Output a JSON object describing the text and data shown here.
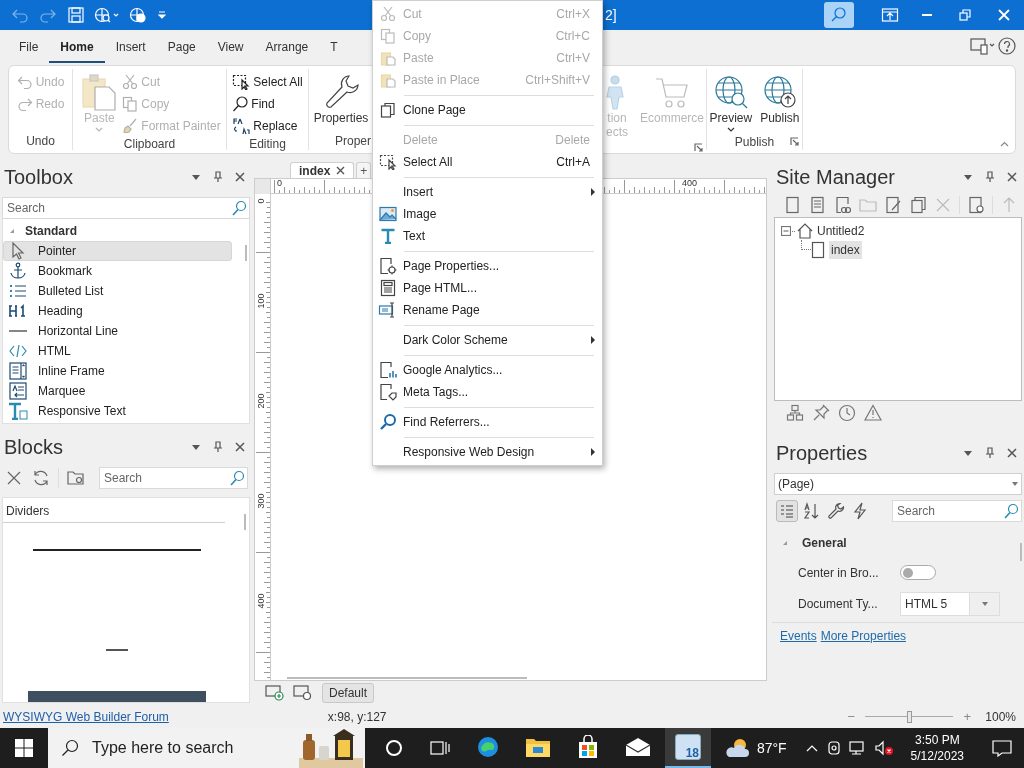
{
  "title_bar": {
    "title": "2]"
  },
  "ribbon": {
    "tabs": [
      {
        "label": "File",
        "selected": false
      },
      {
        "label": "Home",
        "selected": true
      },
      {
        "label": "Insert",
        "selected": false
      },
      {
        "label": "Page",
        "selected": false
      },
      {
        "label": "View",
        "selected": false
      },
      {
        "label": "Arrange",
        "selected": false
      },
      {
        "label": "T",
        "selected": false
      }
    ],
    "groups": [
      {
        "label": "Undo",
        "items": [
          {
            "kind": "small",
            "label": "Undo",
            "disabled": true
          },
          {
            "kind": "small",
            "label": "Redo",
            "disabled": true
          }
        ]
      },
      {
        "label": "Clipboard",
        "items": [
          {
            "kind": "large",
            "label": "Paste",
            "disabled": true,
            "dropdown": true
          },
          {
            "kind": "small",
            "label": "Cut",
            "disabled": true
          },
          {
            "kind": "small",
            "label": "Copy",
            "disabled": true
          },
          {
            "kind": "small",
            "label": "Format Painter",
            "disabled": true
          }
        ]
      },
      {
        "label": "Editing",
        "items": [
          {
            "kind": "small",
            "label": "Select All",
            "disabled": false
          },
          {
            "kind": "small",
            "label": "Find",
            "disabled": false
          },
          {
            "kind": "small",
            "label": "Replace",
            "disabled": false
          }
        ]
      },
      {
        "label": "Proper",
        "items": [
          {
            "kind": "large",
            "label": "Properties",
            "disabled": false
          }
        ]
      },
      {
        "launcher": true,
        "items": [
          {
            "kind": "large",
            "label": "tion",
            "second_line": "ects",
            "disabled": true
          },
          {
            "kind": "large",
            "label": "Ecommerce",
            "disabled": true
          }
        ]
      },
      {
        "label": "Publish",
        "launcher": true,
        "items": [
          {
            "kind": "large",
            "label": "Preview",
            "disabled": false,
            "dropdown": true
          },
          {
            "kind": "large",
            "label": "Publish",
            "disabled": false
          }
        ]
      }
    ]
  },
  "toolbox": {
    "title": "Toolbox",
    "search": {
      "placeholder": "Search"
    },
    "category": {
      "label": "Standard",
      "expanded": true
    },
    "items": [
      {
        "label": "Pointer",
        "selected": true
      },
      {
        "label": "Bookmark",
        "selected": false
      },
      {
        "label": "Bulleted List",
        "selected": false
      },
      {
        "label": "Heading",
        "selected": false
      },
      {
        "label": "Horizontal Line",
        "selected": false
      },
      {
        "label": "HTML",
        "selected": false
      },
      {
        "label": "Inline Frame",
        "selected": false
      },
      {
        "label": "Marquee",
        "selected": false
      },
      {
        "label": "Responsive Text",
        "selected": false
      }
    ]
  },
  "blocks": {
    "title": "Blocks",
    "search": {
      "placeholder": "Search"
    },
    "category": "Dividers"
  },
  "editor": {
    "tabs": [
      {
        "label": "index",
        "selected": true
      },
      {
        "label": "+",
        "selected": false
      }
    ],
    "ruler": {
      "horizontal": [
        "0",
        "400"
      ],
      "vertical": [
        "0",
        "100",
        "200",
        "300",
        "400"
      ]
    },
    "breakpoint_button": "Default"
  },
  "context_menu": {
    "items": [
      {
        "kind": "item",
        "label": "Cut",
        "shortcut": "Ctrl+X",
        "disabled": true
      },
      {
        "kind": "item",
        "label": "Copy",
        "shortcut": "Ctrl+C",
        "disabled": true
      },
      {
        "kind": "item",
        "label": "Paste",
        "shortcut": "Ctrl+V",
        "disabled": true
      },
      {
        "kind": "item",
        "label": "Paste in Place",
        "shortcut": "Ctrl+Shift+V",
        "disabled": true
      },
      {
        "kind": "separator"
      },
      {
        "kind": "item",
        "label": "Clone Page",
        "disabled": false
      },
      {
        "kind": "separator"
      },
      {
        "kind": "item",
        "label": "Delete",
        "shortcut": "Delete",
        "disabled": true
      },
      {
        "kind": "item",
        "label": "Select All",
        "shortcut": "Ctrl+A",
        "disabled": false
      },
      {
        "kind": "separator"
      },
      {
        "kind": "submenu",
        "label": "Insert",
        "disabled": false
      },
      {
        "kind": "item",
        "label": "Image",
        "disabled": false
      },
      {
        "kind": "item",
        "label": "Text",
        "disabled": false
      },
      {
        "kind": "separator"
      },
      {
        "kind": "item",
        "label": "Page Properties...",
        "disabled": false
      },
      {
        "kind": "item",
        "label": "Page HTML...",
        "disabled": false
      },
      {
        "kind": "item",
        "label": "Rename Page",
        "disabled": false
      },
      {
        "kind": "separator"
      },
      {
        "kind": "submenu",
        "label": "Dark Color Scheme",
        "disabled": false
      },
      {
        "kind": "separator"
      },
      {
        "kind": "item",
        "label": "Google Analytics...",
        "disabled": false
      },
      {
        "kind": "item",
        "label": "Meta Tags...",
        "disabled": false
      },
      {
        "kind": "separator"
      },
      {
        "kind": "item",
        "label": "Find Referrers...",
        "disabled": false
      },
      {
        "kind": "separator"
      },
      {
        "kind": "submenu",
        "label": "Responsive Web Design",
        "disabled": false
      }
    ]
  },
  "site_manager": {
    "title": "Site Manager",
    "tree": [
      {
        "label": "Untitled2",
        "expanded": true,
        "selected": false,
        "children": [
          {
            "label": "index",
            "selected": true
          }
        ]
      }
    ]
  },
  "properties": {
    "title": "Properties",
    "object": "(Page)",
    "search": {
      "placeholder": "Search"
    },
    "section": {
      "label": "General",
      "expanded": true
    },
    "rows": [
      {
        "kind": "toggle",
        "label": "Center in Bro...",
        "on": false
      },
      {
        "kind": "dropdown",
        "label": "Document Ty...",
        "value": "HTML 5"
      }
    ],
    "links": [
      "Events",
      "More Properties"
    ]
  },
  "status_bar": {
    "link": "WYSIWYG Web Builder Forum",
    "coordinates": "x:98, y:127",
    "zoom_minus": "−",
    "zoom_plus": "+",
    "zoom": {
      "level": 0.5
    },
    "zoom_text": "100%"
  },
  "taskbar": {
    "search": {
      "placeholder": "Type here to search"
    },
    "apps": [
      {
        "selected": false
      },
      {
        "selected": false
      },
      {
        "selected": false
      },
      {
        "selected": false
      },
      {
        "selected": true,
        "badge": "18"
      }
    ],
    "weather": "87°F",
    "time": "3:50 PM",
    "date": "5/12/2023"
  }
}
